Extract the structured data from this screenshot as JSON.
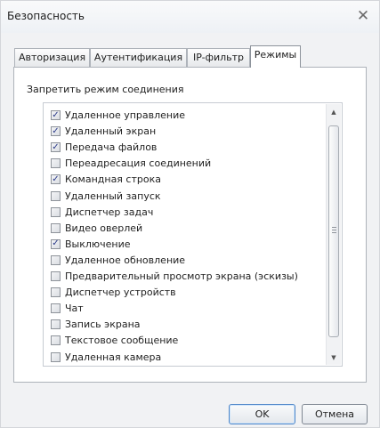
{
  "window": {
    "title": "Безопасность",
    "close_icon": "close-icon"
  },
  "tabs": [
    {
      "label": "Авторизация",
      "active": false
    },
    {
      "label": "Аутентификация",
      "active": false
    },
    {
      "label": "IP-фильтр",
      "active": false
    },
    {
      "label": "Режимы",
      "active": true
    }
  ],
  "modes": {
    "group_label": "Запретить режим соединения",
    "items": [
      {
        "label": "Удаленное управление",
        "checked": true
      },
      {
        "label": "Удаленный экран",
        "checked": true
      },
      {
        "label": "Передача файлов",
        "checked": true
      },
      {
        "label": "Переадресация соединений",
        "checked": false
      },
      {
        "label": "Командная строка",
        "checked": true
      },
      {
        "label": "Удаленный запуск",
        "checked": false
      },
      {
        "label": "Диспетчер задач",
        "checked": false
      },
      {
        "label": "Видео оверлей",
        "checked": false
      },
      {
        "label": "Выключение",
        "checked": true
      },
      {
        "label": "Удаленное обновление",
        "checked": false
      },
      {
        "label": "Предварительный просмотр экрана (эскизы)",
        "checked": false
      },
      {
        "label": "Диспетчер устройств",
        "checked": false
      },
      {
        "label": "Чат",
        "checked": false
      },
      {
        "label": "Запись экрана",
        "checked": false
      },
      {
        "label": "Текстовое сообщение",
        "checked": false
      },
      {
        "label": "Удаленная камера",
        "checked": false
      }
    ]
  },
  "buttons": {
    "ok": "OK",
    "cancel": "Отмена"
  }
}
